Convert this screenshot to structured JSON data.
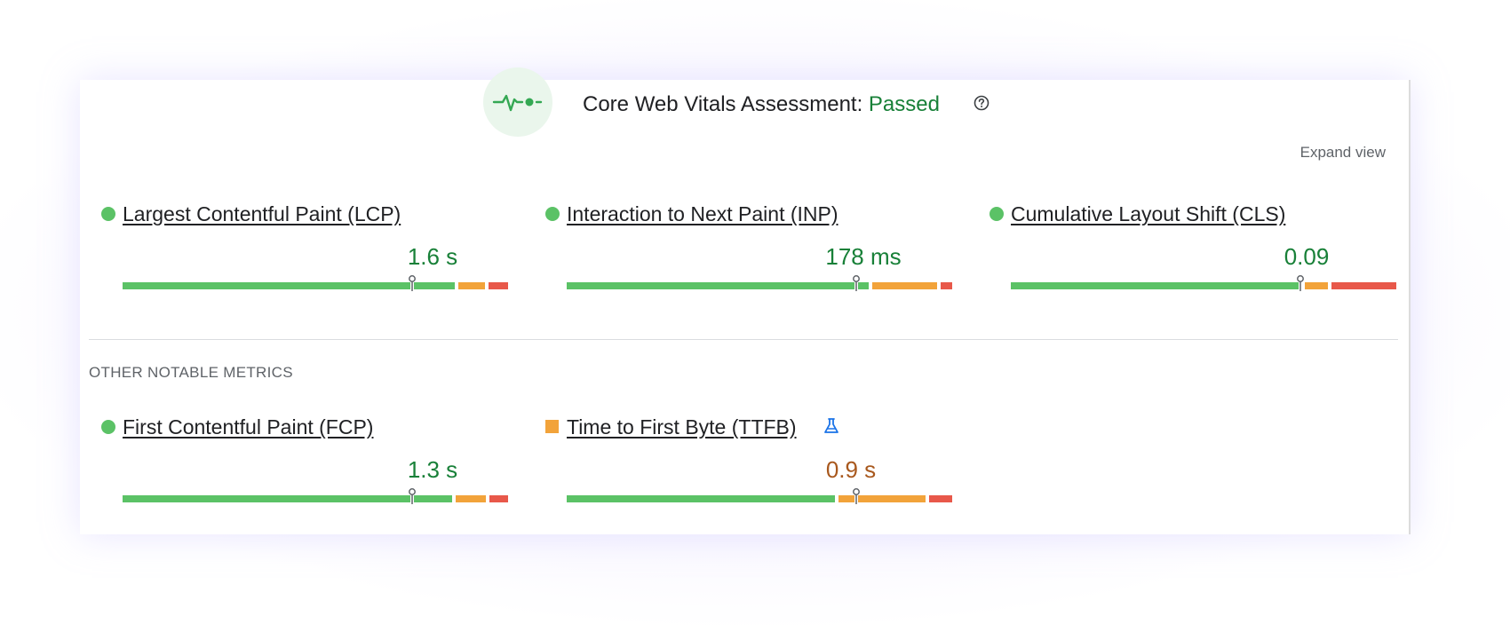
{
  "header": {
    "title": "Core Web Vitals Assessment:",
    "status": "Passed",
    "help_icon": "help-circle-icon",
    "vitals_icon": "pulse-icon",
    "expand_label": "Expand view"
  },
  "colors": {
    "good": "#5bc266",
    "needs_improvement": "#f2a33a",
    "poor": "#e8584a",
    "status_good_text": "#188038",
    "status_ni_text": "#a8581d"
  },
  "core_metrics": [
    {
      "name": "Largest Contentful Paint (LCP)",
      "value": "1.6 s",
      "rating": "good",
      "distribution": {
        "good": 0.87,
        "needs_improvement": 0.07,
        "poor": 0.05
      },
      "marker_position": 0.75
    },
    {
      "name": "Interaction to Next Paint (INP)",
      "value": "178 ms",
      "rating": "good",
      "distribution": {
        "good": 0.79,
        "needs_improvement": 0.17,
        "poor": 0.03
      },
      "marker_position": 0.75
    },
    {
      "name": "Cumulative Layout Shift (CLS)",
      "value": "0.09",
      "rating": "good",
      "distribution": {
        "good": 0.76,
        "needs_improvement": 0.06,
        "poor": 0.17
      },
      "marker_position": 0.75
    }
  ],
  "other_section_label": "OTHER NOTABLE METRICS",
  "other_metrics": [
    {
      "name": "First Contentful Paint (FCP)",
      "value": "1.3 s",
      "rating": "good",
      "distribution": {
        "good": 0.87,
        "needs_improvement": 0.08,
        "poor": 0.05
      },
      "marker_position": 0.75
    },
    {
      "name": "Time to First Byte (TTFB)",
      "value": "0.9 s",
      "rating": "needs_improvement",
      "experimental_icon": "flask-icon",
      "distribution": {
        "good": 0.71,
        "needs_improvement": 0.23,
        "poor": 0.06
      },
      "marker_position": 0.75
    }
  ]
}
